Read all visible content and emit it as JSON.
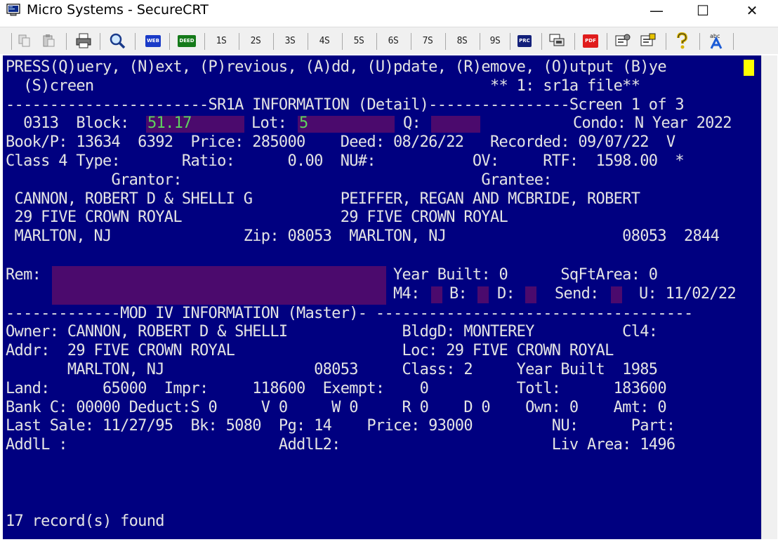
{
  "window": {
    "title": "Micro Systems - SecureCRT",
    "minimize": "—",
    "maximize": "☐",
    "close": "✕"
  },
  "toolbar": {
    "session_buttons": [
      "1S",
      "2S",
      "3S",
      "4S",
      "5S",
      "6S",
      "7S",
      "8S",
      "9S"
    ],
    "web_label": "WEB",
    "deed_label": "DEED",
    "prc_label": "PRC",
    "pdf_label": "PDF",
    "abc_label": "abc"
  },
  "terminal": {
    "l1": "PRESS(Q)uery, (N)ext, (P)revious, (A)dd, (U)pdate, (R)emove, (O)utput (B)ye",
    "l2a": "  (S)creen",
    "l2b": "** 1: sr1a file**",
    "l3": "-----------------------SR1A INFORMATION (Detail)----------------Screen 1 of 3",
    "l4a": "  0313  Block:",
    "block": "51.17",
    "l4b": "Lot:",
    "lot": "5",
    "l4c": "Q:",
    "l4d": "Condo: N Year 2022",
    "l5": "Book/P: 13634  6392  Price: 285000    Deed: 08/26/22   Recorded: 09/07/22  V",
    "l6": "Class 4 Type:       Ratio:      0.00  NU#:           OV:     RTF:  1598.00  *",
    "l7": "            Grantor:                                  Grantee:",
    "l8": " CANNON, ROBERT D & SHELLI G          PEIFFER, REGAN AND MCBRIDE, ROBERT",
    "l9": " 29 FIVE CROWN ROYAL                  29 FIVE CROWN ROYAL",
    "l10": " MARLTON, NJ               Zip: 08053  MARLTON, NJ                    08053  2844",
    "l12a": "Rem:",
    "l12b": "Year Built: 0      SqFtArea: 0",
    "l13a": "M4:",
    "l13b": "B:",
    "l13c": "D:",
    "l13d": "Send:",
    "l13e": "U: 11/02/22",
    "l14": "-------------MOD IV INFORMATION (Master)- ------------------------------------",
    "l15": "Owner: CANNON, ROBERT D & SHELLI             BldgD: MONTEREY          Cl4:",
    "l16": "Addr:  29 FIVE CROWN ROYAL                   Loc: 29 FIVE CROWN ROYAL",
    "l17": "       MARLTON, NJ                 08053     Class: 2     Year Built  1985",
    "l18": "Land:      65000  Impr:     118600  Exempt:    0          Totl:      183600",
    "l19": "Bank C: 00000 Deduct:S 0     V 0     W 0     R 0    D 0    Own: 0    Amt: 0",
    "l20": "Last Sale: 11/27/95  Bk: 5080  Pg: 14    Price: 93000         NU:      Part:",
    "l21": "AddlL :                        AddlL2:                        Liv Area: 1496",
    "status": "17 record(s) found"
  }
}
